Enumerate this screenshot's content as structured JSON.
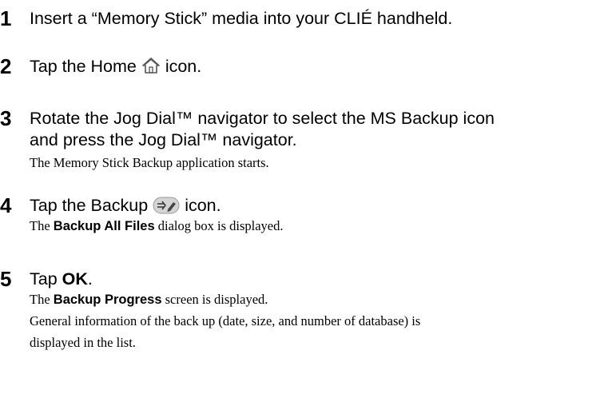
{
  "steps": [
    {
      "number": "1",
      "text": "Insert a “Memory Stick” media into your CLIÉ handheld."
    },
    {
      "number": "2",
      "text_before": "Tap the Home",
      "icon": "home-icon",
      "text_after": "icon."
    },
    {
      "number": "3",
      "line1": "Rotate the Jog Dial™ navigator to select the MS Backup icon",
      "line2": "and press the Jog Dial™ navigator.",
      "note": "The Memory Stick Backup application starts."
    },
    {
      "number": "4",
      "text_before": "Tap the Backup",
      "icon": "backup-icon",
      "text_after": "icon.",
      "note_pre": "The",
      "note_bold": "Backup All Files",
      "note_post": "dialog box is displayed."
    },
    {
      "number": "5",
      "text_before": "Tap",
      "text_bold": "OK",
      "text_after": ".",
      "note1_pre": "The",
      "note1_bold": "Backup Progress",
      "note1_post": "screen is displayed.",
      "note2_line1": "General information of the back up (date, size, and number of database) is",
      "note2_line2": "displayed in the list."
    }
  ]
}
